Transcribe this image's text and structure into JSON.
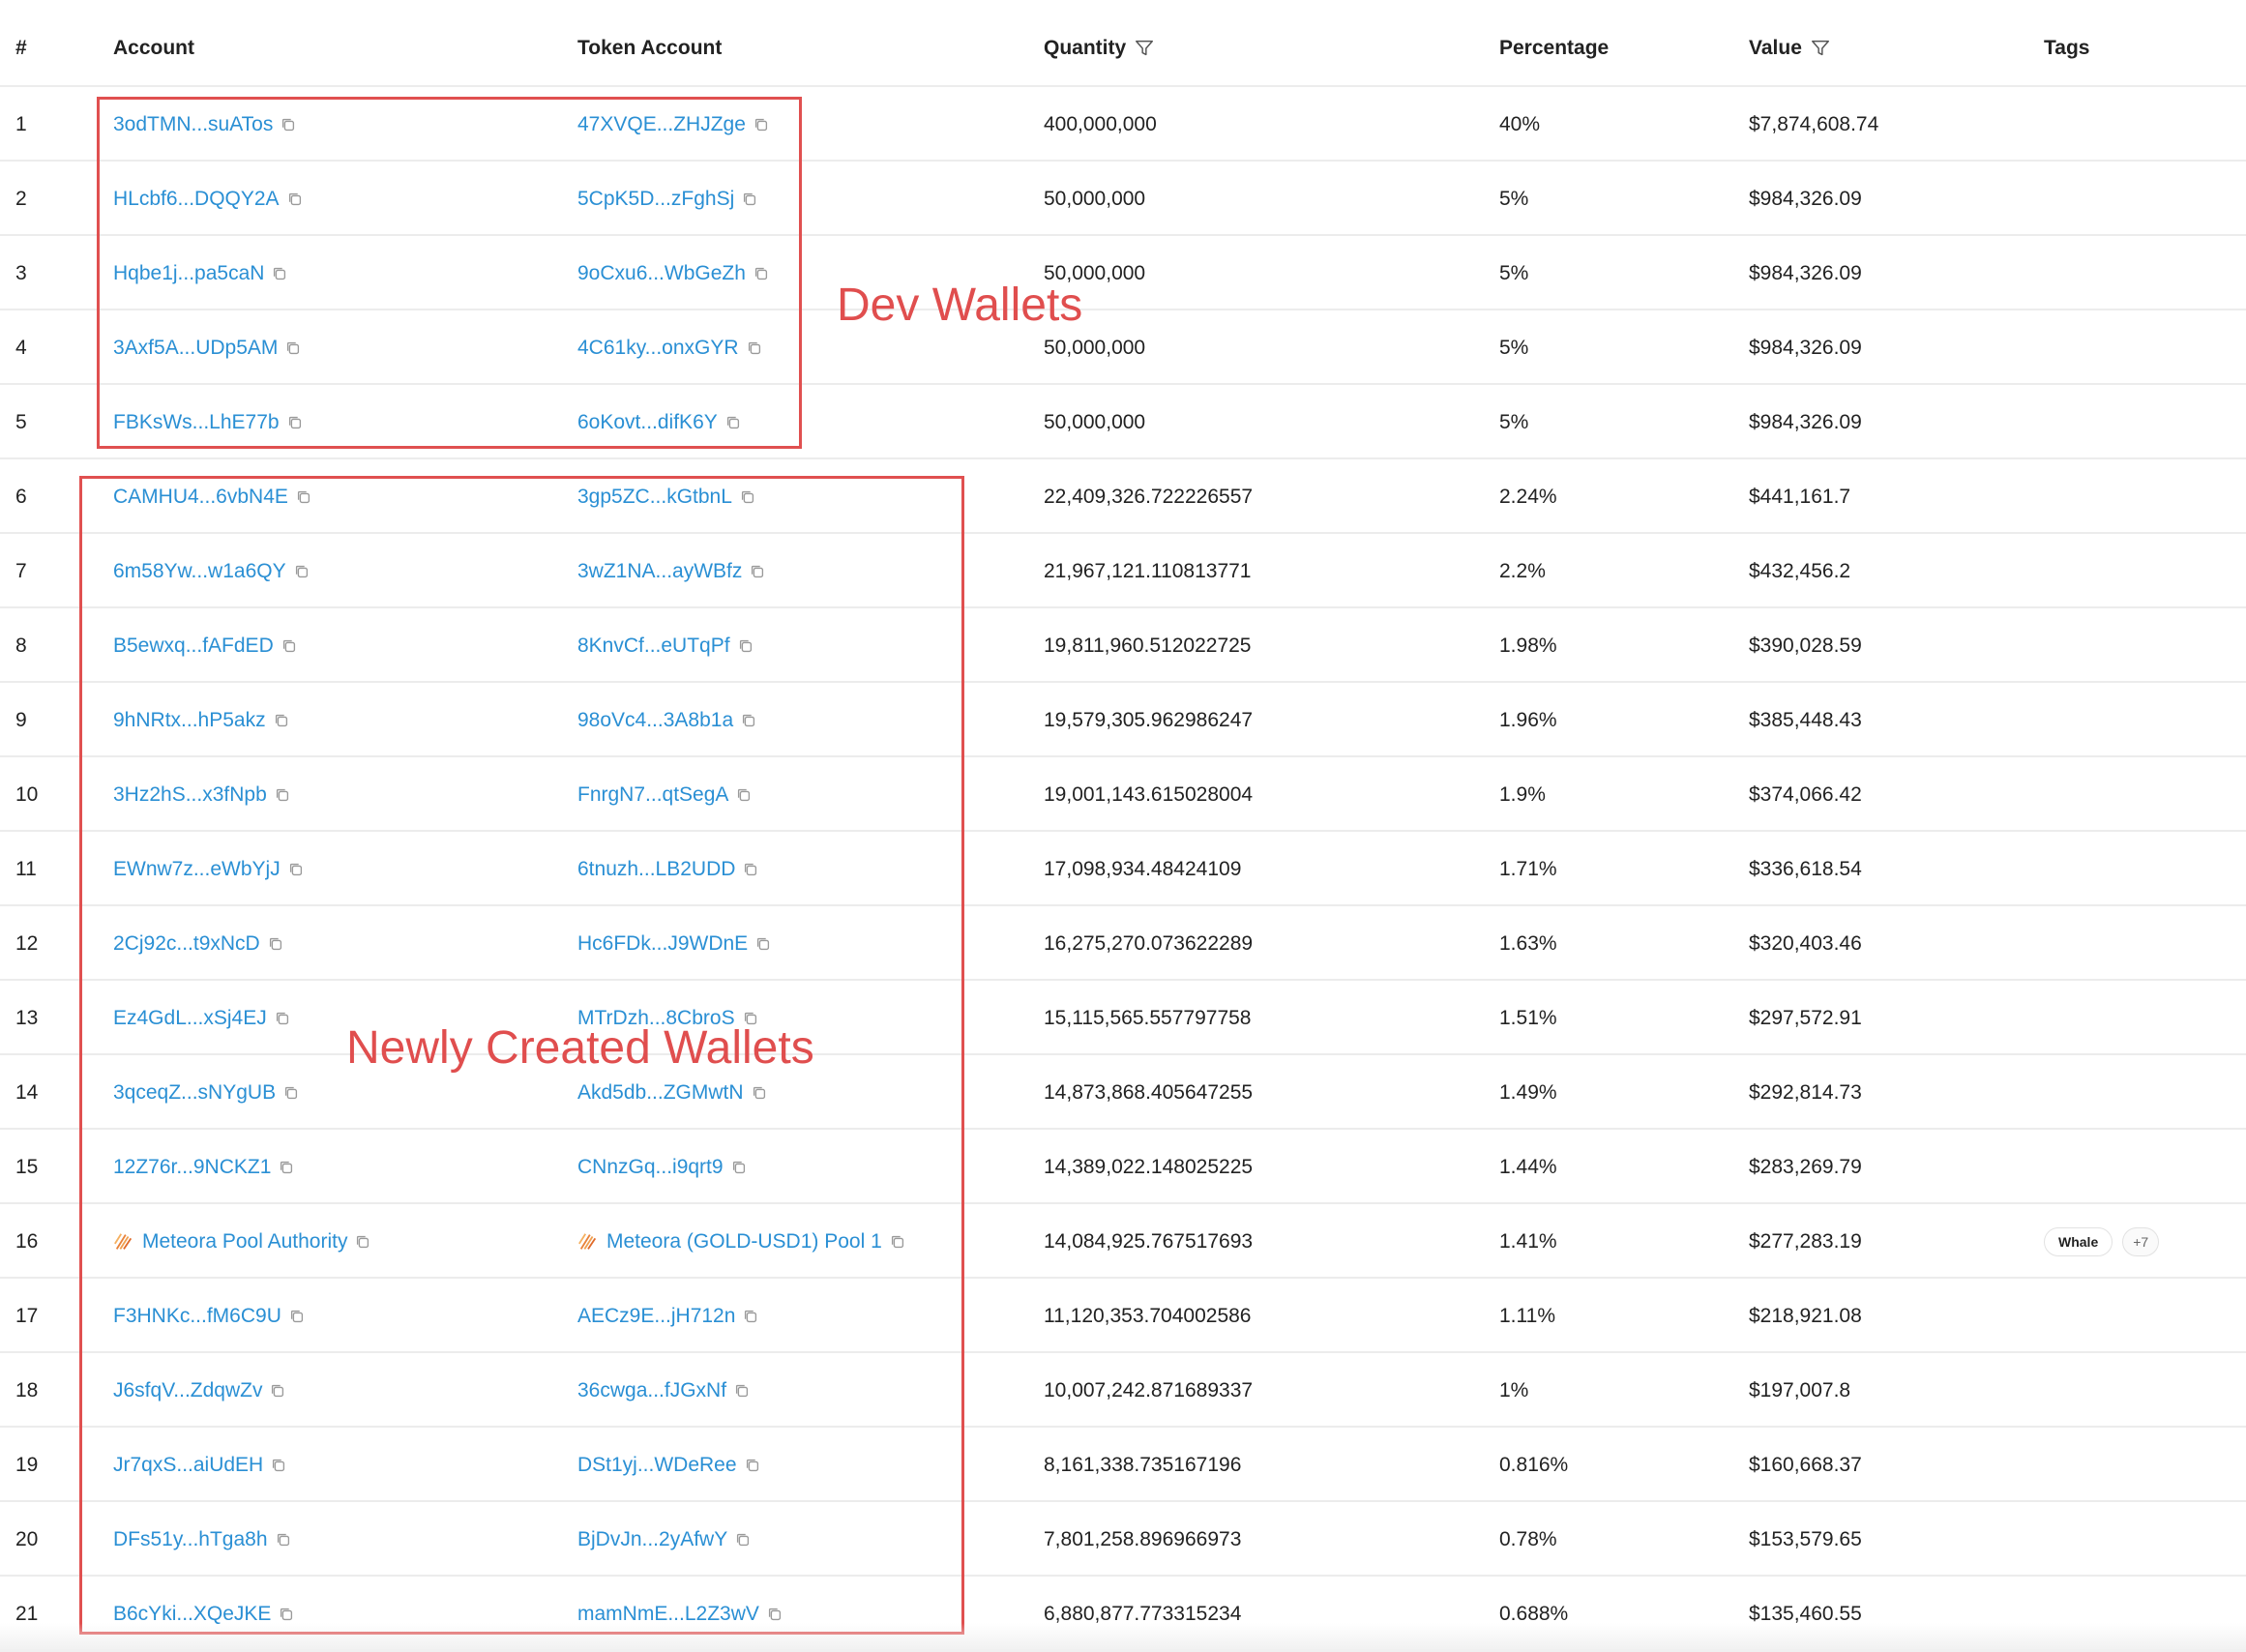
{
  "header": {
    "num": "#",
    "account": "Account",
    "token_account": "Token Account",
    "quantity": "Quantity",
    "percentage": "Percentage",
    "value": "Value",
    "tags": "Tags"
  },
  "annotations": {
    "dev_wallets": "Dev Wallets",
    "new_wallets": "Newly Created Wallets",
    "color": "#e05050"
  },
  "colors": {
    "link": "#2a8fd4",
    "meteora": "#e8823a"
  },
  "rows": [
    {
      "num": "1",
      "account": "3odTMN...suATos",
      "token": "47XVQE...ZHJZge",
      "qty": "400,000,000",
      "pct": "40%",
      "value": "$7,874,608.74"
    },
    {
      "num": "2",
      "account": "HLcbf6...DQQY2A",
      "token": "5CpK5D...zFghSj",
      "qty": "50,000,000",
      "pct": "5%",
      "value": "$984,326.09"
    },
    {
      "num": "3",
      "account": "Hqbe1j...pa5caN",
      "token": "9oCxu6...WbGeZh",
      "qty": "50,000,000",
      "pct": "5%",
      "value": "$984,326.09"
    },
    {
      "num": "4",
      "account": "3Axf5A...UDp5AM",
      "token": "4C61ky...onxGYR",
      "qty": "50,000,000",
      "pct": "5%",
      "value": "$984,326.09"
    },
    {
      "num": "5",
      "account": "FBKsWs...LhE77b",
      "token": "6oKovt...difK6Y",
      "qty": "50,000,000",
      "pct": "5%",
      "value": "$984,326.09"
    },
    {
      "num": "6",
      "account": "CAMHU4...6vbN4E",
      "token": "3gp5ZC...kGtbnL",
      "qty": "22,409,326.722226557",
      "pct": "2.24%",
      "value": "$441,161.7"
    },
    {
      "num": "7",
      "account": "6m58Yw...w1a6QY",
      "token": "3wZ1NA...ayWBfz",
      "qty": "21,967,121.110813771",
      "pct": "2.2%",
      "value": "$432,456.2"
    },
    {
      "num": "8",
      "account": "B5ewxq...fAFdED",
      "token": "8KnvCf...eUTqPf",
      "qty": "19,811,960.512022725",
      "pct": "1.98%",
      "value": "$390,028.59"
    },
    {
      "num": "9",
      "account": "9hNRtx...hP5akz",
      "token": "98oVc4...3A8b1a",
      "qty": "19,579,305.962986247",
      "pct": "1.96%",
      "value": "$385,448.43"
    },
    {
      "num": "10",
      "account": "3Hz2hS...x3fNpb",
      "token": "FnrgN7...qtSegA",
      "qty": "19,001,143.615028004",
      "pct": "1.9%",
      "value": "$374,066.42"
    },
    {
      "num": "11",
      "account": "EWnw7z...eWbYjJ",
      "token": "6tnuzh...LB2UDD",
      "qty": "17,098,934.48424109",
      "pct": "1.71%",
      "value": "$336,618.54"
    },
    {
      "num": "12",
      "account": "2Cj92c...t9xNcD",
      "token": "Hc6FDk...J9WDnE",
      "qty": "16,275,270.073622289",
      "pct": "1.63%",
      "value": "$320,403.46"
    },
    {
      "num": "13",
      "account": "Ez4GdL...xSj4EJ",
      "token": "MTrDzh...8CbroS",
      "qty": "15,115,565.557797758",
      "pct": "1.51%",
      "value": "$297,572.91"
    },
    {
      "num": "14",
      "account": "3qceqZ...sNYgUB",
      "token": "Akd5db...ZGMwtN",
      "qty": "14,873,868.405647255",
      "pct": "1.49%",
      "value": "$292,814.73"
    },
    {
      "num": "15",
      "account": "12Z76r...9NCKZ1",
      "token": "CNnzGq...i9qrt9",
      "qty": "14,389,022.148025225",
      "pct": "1.44%",
      "value": "$283,269.79"
    },
    {
      "num": "16",
      "account": "Meteora Pool Authority",
      "token": "Meteora (GOLD-USD1) Pool 1",
      "qty": "14,084,925.767517693",
      "pct": "1.41%",
      "value": "$277,283.19",
      "meteora": true,
      "tags": [
        "Whale"
      ],
      "more": "+7"
    },
    {
      "num": "17",
      "account": "F3HNKc...fM6C9U",
      "token": "AECz9E...jH712n",
      "qty": "11,120,353.704002586",
      "pct": "1.11%",
      "value": "$218,921.08"
    },
    {
      "num": "18",
      "account": "J6sfqV...ZdqwZv",
      "token": "36cwga...fJGxNf",
      "qty": "10,007,242.871689337",
      "pct": "1%",
      "value": "$197,007.8"
    },
    {
      "num": "19",
      "account": "Jr7qxS...aiUdEH",
      "token": "DSt1yj...WDeRee",
      "qty": "8,161,338.735167196",
      "pct": "0.816%",
      "value": "$160,668.37"
    },
    {
      "num": "20",
      "account": "DFs51y...hTga8h",
      "token": "BjDvJn...2yAfwY",
      "qty": "7,801,258.896966973",
      "pct": "0.78%",
      "value": "$153,579.65"
    },
    {
      "num": "21",
      "account": "B6cYki...XQeJKE",
      "token": "mamNmE...L2Z3wV",
      "qty": "6,880,877.773315234",
      "pct": "0.688%",
      "value": "$135,460.55"
    }
  ]
}
